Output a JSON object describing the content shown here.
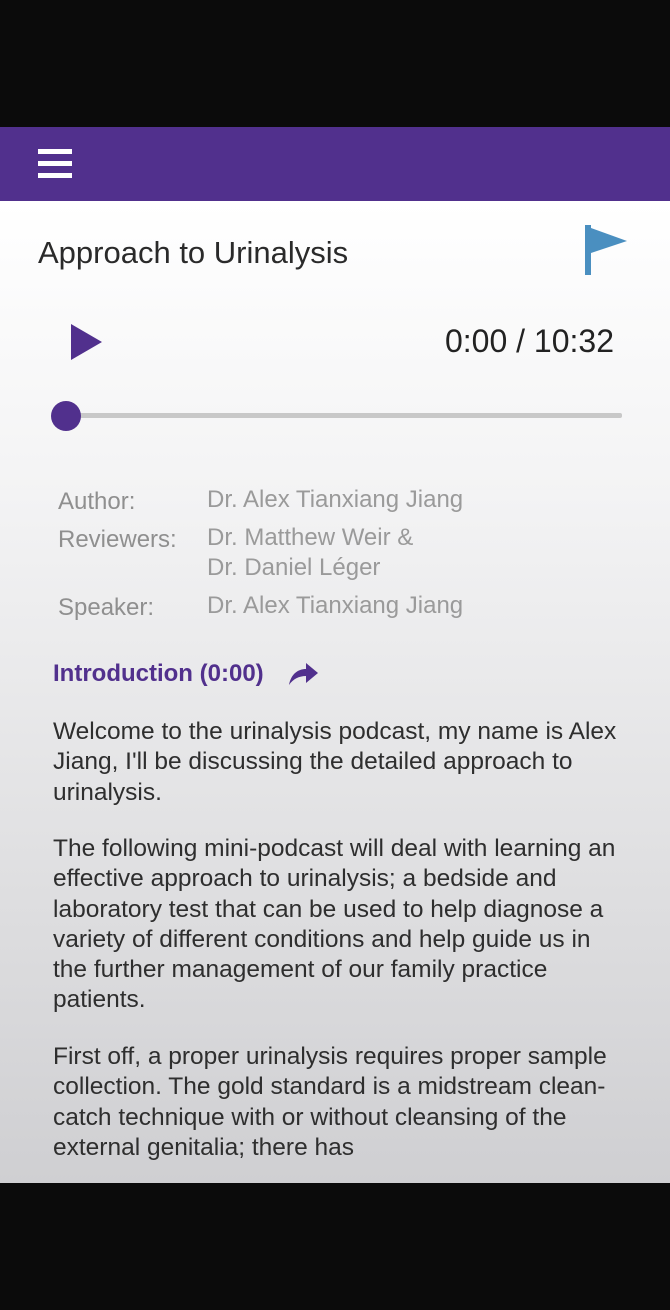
{
  "header": {
    "menu_icon": "hamburger-menu-icon",
    "accent_color": "#51308d"
  },
  "episode": {
    "title": "Approach to Urinalysis",
    "flag_icon": "flag-icon",
    "flag_color": "#4a8fc0"
  },
  "player": {
    "play_icon": "play-icon",
    "time_display": "0:00 / 10:32",
    "progress": 0
  },
  "credits": {
    "author_label": "Author:",
    "author_value": "Dr. Alex Tianxiang Jiang",
    "reviewers_label": "Reviewers:",
    "reviewers_line1": "Dr. Matthew Weir &",
    "reviewers_line2": "Dr. Daniel Léger",
    "speaker_label": "Speaker:",
    "speaker_value": "Dr. Alex Tianxiang Jiang"
  },
  "transcript": {
    "section_heading": "Introduction (0:00)",
    "share_icon": "share-arrow-icon",
    "paragraphs": [
      "Welcome to the urinalysis podcast, my name is Alex Jiang, I'll be discussing the detailed approach to urinalysis.",
      "The following mini-podcast will deal with learning an effective approach to urinalysis; a bedside and laboratory test that can be used to help diagnose a variety of different conditions and help guide us in the further management of our family practice patients.",
      "First off, a proper urinalysis requires proper sample collection. The gold standard is a midstream clean-catch technique with or without cleansing of the external genitalia; there has"
    ]
  }
}
